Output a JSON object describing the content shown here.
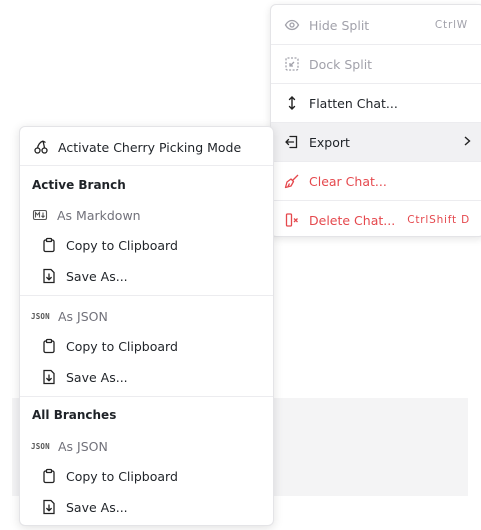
{
  "main_menu": {
    "items": [
      {
        "label": "Hide Split",
        "shortcut": "CtrlW",
        "icon": "eye-icon"
      },
      {
        "label": "Dock Split",
        "icon": "dock-icon"
      },
      {
        "label": "Flatten Chat...",
        "icon": "vertical-arrows-icon"
      },
      {
        "label": "Export",
        "icon": "export-icon",
        "submenu_indicator": ">"
      },
      {
        "label": "Clear Chat...",
        "icon": "broom-icon"
      },
      {
        "label": "Delete Chat...",
        "shortcut": "CtrlShift D",
        "icon": "delete-icon"
      }
    ]
  },
  "export_menu": {
    "cherry_picking": "Activate Cherry Picking Mode",
    "active_branch": {
      "heading": "Active Branch",
      "markdown": {
        "icon_text": "M↓",
        "label": "As Markdown",
        "copy": "Copy to Clipboard",
        "save": "Save As..."
      },
      "json": {
        "icon_text": "JSON",
        "label": "As JSON",
        "copy": "Copy to Clipboard",
        "save": "Save As..."
      }
    },
    "all_branches": {
      "heading": "All Branches",
      "json": {
        "icon_text": "JSON",
        "label": "As JSON",
        "copy": "Copy to Clipboard",
        "save": "Save As..."
      }
    }
  },
  "colors": {
    "danger": "#e5484d",
    "disabled": "#a1a1aa",
    "highlight": "#f1f1f3"
  }
}
